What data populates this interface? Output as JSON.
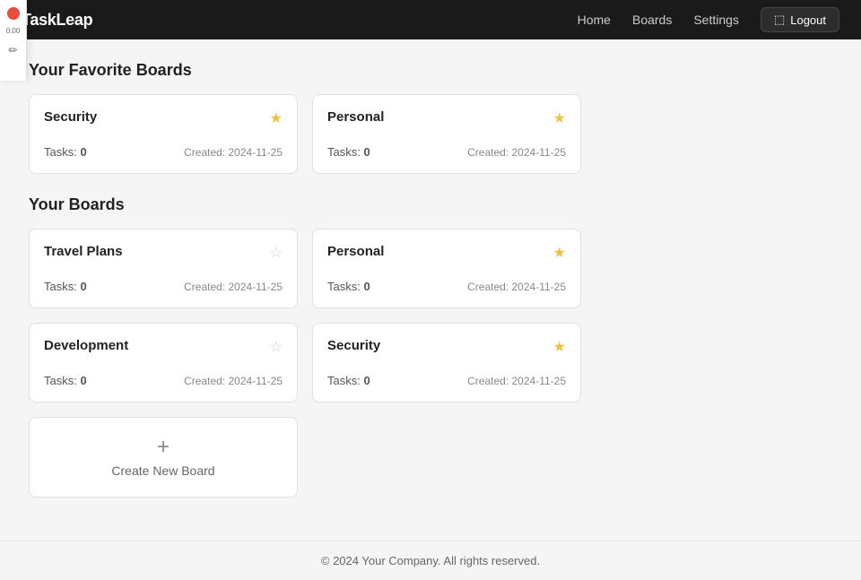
{
  "navbar": {
    "brand": "TaskLeap",
    "links": [
      {
        "label": "Home",
        "name": "home"
      },
      {
        "label": "Boards",
        "name": "boards"
      },
      {
        "label": "Settings",
        "name": "settings"
      }
    ],
    "logout_label": "Logout"
  },
  "favorite_boards_section": {
    "title": "Your Favorite Boards",
    "cards": [
      {
        "id": "fav-security",
        "title": "Security",
        "tasks_label": "Tasks:",
        "tasks_count": "0",
        "date_label": "Created:",
        "date": "2024-11-25",
        "starred": true
      },
      {
        "id": "fav-personal",
        "title": "Personal",
        "tasks_label": "Tasks:",
        "tasks_count": "0",
        "date_label": "Created:",
        "date": "2024-11-25",
        "starred": true
      }
    ]
  },
  "your_boards_section": {
    "title": "Your Boards",
    "cards": [
      {
        "id": "board-travel",
        "title": "Travel Plans",
        "tasks_label": "Tasks:",
        "tasks_count": "0",
        "date_label": "Created:",
        "date": "2024-11-25",
        "starred": false
      },
      {
        "id": "board-personal",
        "title": "Personal",
        "tasks_label": "Tasks:",
        "tasks_count": "0",
        "date_label": "Created:",
        "date": "2024-11-25",
        "starred": true
      },
      {
        "id": "board-development",
        "title": "Development",
        "tasks_label": "Tasks:",
        "tasks_count": "0",
        "date_label": "Created:",
        "date": "2024-11-25",
        "starred": false
      },
      {
        "id": "board-security",
        "title": "Security",
        "tasks_label": "Tasks:",
        "tasks_count": "0",
        "date_label": "Created:",
        "date": "2024-11-25",
        "starred": true
      }
    ],
    "create_label": "Create New Board"
  },
  "footer": {
    "text": "© 2024 Your Company. All rights reserved."
  },
  "side_panel": {
    "time": "0:00"
  }
}
